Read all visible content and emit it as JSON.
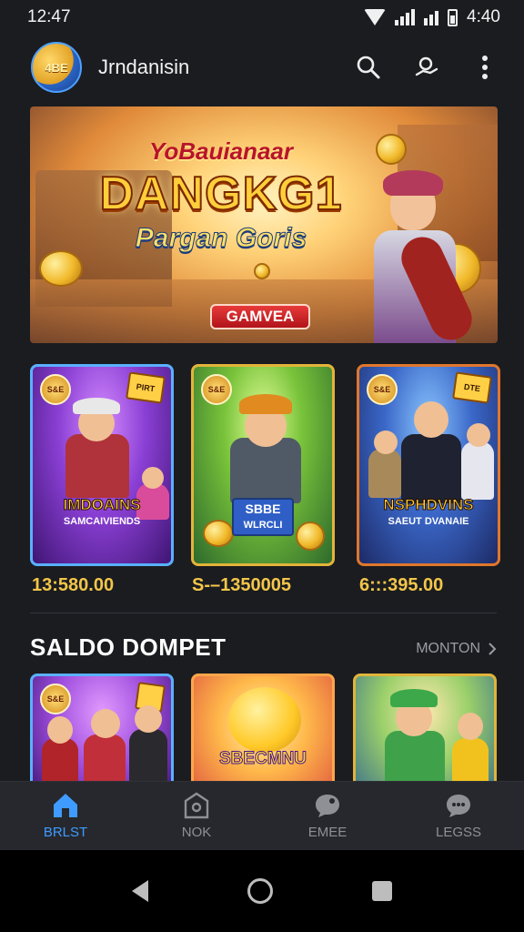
{
  "status_bar": {
    "time_left": "12:47",
    "time_right": "4:40"
  },
  "app_bar": {
    "logo_text": "4BE",
    "title": "Jrndanisin"
  },
  "banner": {
    "subtitle": "YoBauianaar",
    "title": "DANGKG1",
    "tagline": "Pargan Goris",
    "cta_label": "GAMVEA"
  },
  "games": [
    {
      "badge": "S&E",
      "corner": "PIRT",
      "label": "IMDOAINS",
      "sublabel": "SAMCAIVIENDS",
      "price": "13:580.00"
    },
    {
      "badge": "S&E",
      "corner": "",
      "label": "SBBE",
      "sublabel": "WLRCLI",
      "price": "S-–1350005"
    },
    {
      "badge": "S&E",
      "corner": "DTE",
      "label": "NSPHDVINS",
      "sublabel": "SAEUT DVANAIE",
      "price": "6:::395.00"
    }
  ],
  "section": {
    "title": "SALDO DOMPET",
    "more_label": "MONTON"
  },
  "wallet_cards": [
    {
      "badge": "S&E",
      "label": ""
    },
    {
      "badge": "",
      "label": "SBECMNU"
    },
    {
      "badge": "",
      "label": ""
    }
  ],
  "bottom_nav": [
    {
      "label": "BRLST",
      "icon": "home-icon",
      "active": true
    },
    {
      "label": "NOK",
      "icon": "box-icon",
      "active": false
    },
    {
      "label": "EMEE",
      "icon": "chat-icon",
      "active": false
    },
    {
      "label": "LEGSS",
      "icon": "message-icon",
      "active": false
    }
  ],
  "colors": {
    "accent": "#3f9bff",
    "price": "#f3c64a",
    "background": "#1b1c20"
  }
}
